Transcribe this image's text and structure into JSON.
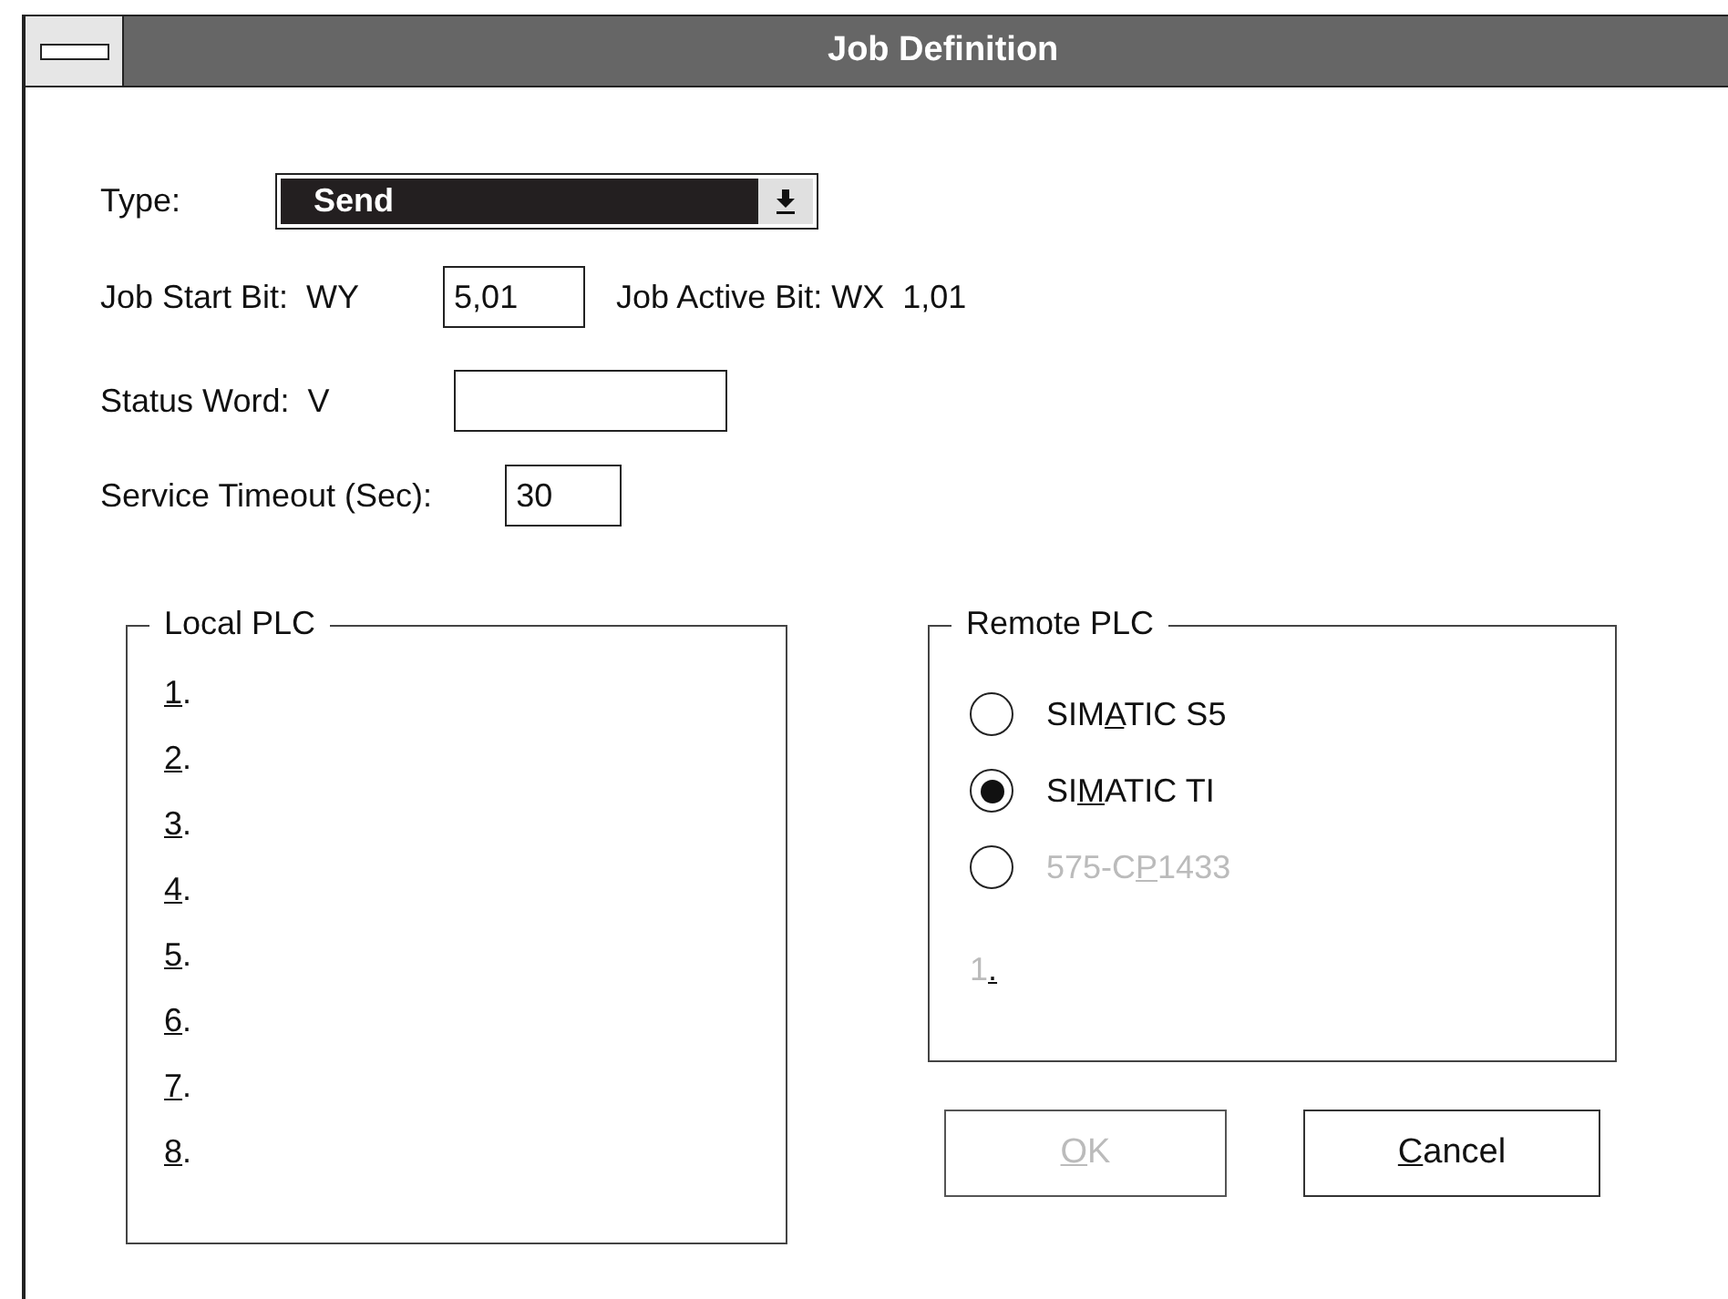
{
  "window": {
    "title": "Job Definition"
  },
  "type_field": {
    "label": "Type:",
    "value": "Send"
  },
  "job_start_bit": {
    "label": "Job Start Bit:  WY",
    "value": "5,01"
  },
  "job_active_bit": {
    "label": "Job Active Bit: WX  1,01"
  },
  "status_word": {
    "label": "Status Word:  V"
  },
  "service_timeout": {
    "label": "Service Timeout (Sec):",
    "value": "30"
  },
  "local_plc": {
    "title": "Local PLC",
    "items": [
      {
        "label": {
          "key": "1",
          "post": "."
        }
      },
      {
        "label": {
          "key": "2",
          "post": "."
        }
      },
      {
        "label": {
          "key": "3",
          "post": "."
        }
      },
      {
        "label": {
          "key": "4",
          "post": "."
        }
      },
      {
        "label": {
          "key": "5",
          "post": "."
        }
      },
      {
        "label": {
          "key": "6",
          "post": "."
        }
      },
      {
        "label": {
          "key": "7",
          "post": "."
        }
      },
      {
        "label": {
          "key": "8",
          "post": "."
        }
      }
    ]
  },
  "remote_plc": {
    "title": "Remote PLC",
    "options": [
      {
        "label": {
          "pre": "SIM",
          "key": "A",
          "post": "TIC S5"
        },
        "selected": false,
        "disabled": false
      },
      {
        "label": {
          "pre": "SI",
          "key": "M",
          "post": "ATIC TI"
        },
        "selected": true,
        "disabled": false
      },
      {
        "label": {
          "pre": "575-C",
          "key": "P",
          "post": "1433"
        },
        "selected": false,
        "disabled": true
      }
    ],
    "entry": {
      "label": {
        "pre": "1",
        "key": "."
      },
      "disabled": true
    }
  },
  "buttons": [
    {
      "label": {
        "key": "O",
        "post": "K"
      },
      "disabled": true
    },
    {
      "label": {
        "key": "C",
        "post": "ancel"
      },
      "disabled": false
    }
  ]
}
